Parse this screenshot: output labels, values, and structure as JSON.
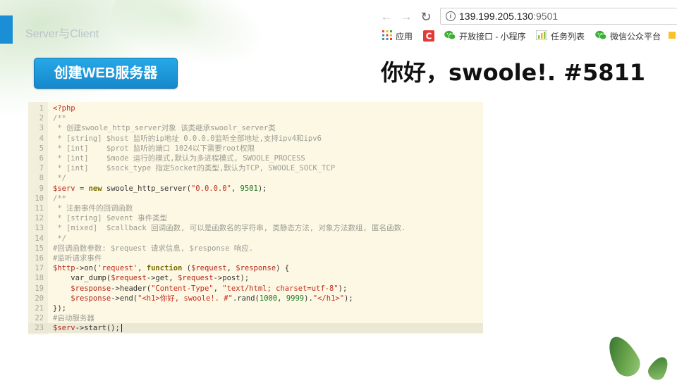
{
  "slide": {
    "title": "Server与Client",
    "button_label": "创建WEB服务器"
  },
  "browser": {
    "url_host": "139.199.205.130",
    "url_port": ":9501",
    "bookmarks": [
      "应用",
      "开放接口 - 小程序",
      "任务列表",
      "微信公众平台"
    ],
    "content": "你好，swoole!. #5811"
  },
  "colors": {
    "accent": "#1a8fd6",
    "button": "#1588cc",
    "code_bg": "#fdf8e4"
  },
  "code": {
    "lines": [
      {
        "n": "1",
        "t": [
          [
            "c-php",
            "<?php"
          ]
        ]
      },
      {
        "n": "2",
        "t": [
          [
            "c-com",
            "/**"
          ]
        ]
      },
      {
        "n": "3",
        "t": [
          [
            "c-com",
            " * 创建swoole_http_server对象 该类继承swoolr_server类"
          ]
        ]
      },
      {
        "n": "4",
        "t": [
          [
            "c-com",
            " * [string] $host 监听的ip地址 0.0.0.0监听全部地址,支持ipv4和ipv6"
          ]
        ]
      },
      {
        "n": "5",
        "t": [
          [
            "c-com",
            " * [int]    $prot 监听的端口 1024以下需要root权限"
          ]
        ]
      },
      {
        "n": "6",
        "t": [
          [
            "c-com",
            " * [int]    $mode 运行的模式,默认为多进程模式, SWOOLE_PROCESS"
          ]
        ]
      },
      {
        "n": "7",
        "t": [
          [
            "c-com",
            " * [int]    $sock_type 指定Socket的类型,默认为TCP, SWOOLE_SOCK_TCP"
          ]
        ]
      },
      {
        "n": "8",
        "t": [
          [
            "c-com",
            " */"
          ]
        ]
      },
      {
        "n": "9",
        "t": [
          [
            "c-var",
            "$serv"
          ],
          [
            "c-fn",
            " = "
          ],
          [
            "c-kw",
            "new"
          ],
          [
            "c-fn",
            " swoole_http_server("
          ],
          [
            "c-str",
            "\"0.0.0.0\""
          ],
          [
            "c-fn",
            ", "
          ],
          [
            "c-num",
            "9501"
          ],
          [
            "c-fn",
            ");"
          ]
        ]
      },
      {
        "n": "10",
        "t": [
          [
            "c-com",
            "/**"
          ]
        ]
      },
      {
        "n": "11",
        "t": [
          [
            "c-com",
            " * 注册事件的回调函数"
          ]
        ]
      },
      {
        "n": "12",
        "t": [
          [
            "c-com",
            " * [string] $event 事件类型"
          ]
        ]
      },
      {
        "n": "13",
        "t": [
          [
            "c-com",
            " * [mixed]  $callback 回调函数, 可以是函数名的字符串, 类静态方法, 对象方法数组, 匿名函数."
          ]
        ]
      },
      {
        "n": "14",
        "t": [
          [
            "c-com",
            " */"
          ]
        ]
      },
      {
        "n": "15",
        "t": [
          [
            "c-com",
            "#回调函数参数: $request 请求信息, $response 响应."
          ]
        ]
      },
      {
        "n": "16",
        "t": [
          [
            "c-com",
            "#监听请求事件"
          ]
        ]
      },
      {
        "n": "17",
        "t": [
          [
            "c-var",
            "$http"
          ],
          [
            "c-fn",
            "->on("
          ],
          [
            "c-str",
            "'request'"
          ],
          [
            "c-fn",
            ", "
          ],
          [
            "c-kw",
            "function"
          ],
          [
            "c-fn",
            " ("
          ],
          [
            "c-var",
            "$request"
          ],
          [
            "c-fn",
            ", "
          ],
          [
            "c-var",
            "$response"
          ],
          [
            "c-fn",
            ") {"
          ]
        ]
      },
      {
        "n": "18",
        "t": [
          [
            "c-fn",
            "    var_dump("
          ],
          [
            "c-var",
            "$request"
          ],
          [
            "c-fn",
            "->get, "
          ],
          [
            "c-var",
            "$request"
          ],
          [
            "c-fn",
            "->post);"
          ]
        ]
      },
      {
        "n": "19",
        "t": [
          [
            "c-fn",
            "    "
          ],
          [
            "c-var",
            "$response"
          ],
          [
            "c-fn",
            "->header("
          ],
          [
            "c-str",
            "\"Content-Type\""
          ],
          [
            "c-fn",
            ", "
          ],
          [
            "c-str",
            "\"text/html; charset=utf-8\""
          ],
          [
            "c-fn",
            ");"
          ]
        ]
      },
      {
        "n": "20",
        "t": [
          [
            "c-fn",
            "    "
          ],
          [
            "c-var",
            "$response"
          ],
          [
            "c-fn",
            "->end("
          ],
          [
            "c-str",
            "\"<h1>你好, swoole!. #\""
          ],
          [
            "c-fn",
            ".rand("
          ],
          [
            "c-num",
            "1000"
          ],
          [
            "c-fn",
            ", "
          ],
          [
            "c-num",
            "9999"
          ],
          [
            "c-fn",
            ")."
          ],
          [
            "c-str",
            "\"</h1>\""
          ],
          [
            "c-fn",
            ");"
          ]
        ]
      },
      {
        "n": "21",
        "t": [
          [
            "c-fn",
            "});"
          ]
        ]
      },
      {
        "n": "22",
        "t": [
          [
            "c-com",
            "#启动服务器"
          ]
        ]
      },
      {
        "n": "23",
        "t": [
          [
            "c-var",
            "$serv"
          ],
          [
            "c-fn",
            "->start();"
          ]
        ]
      }
    ]
  }
}
